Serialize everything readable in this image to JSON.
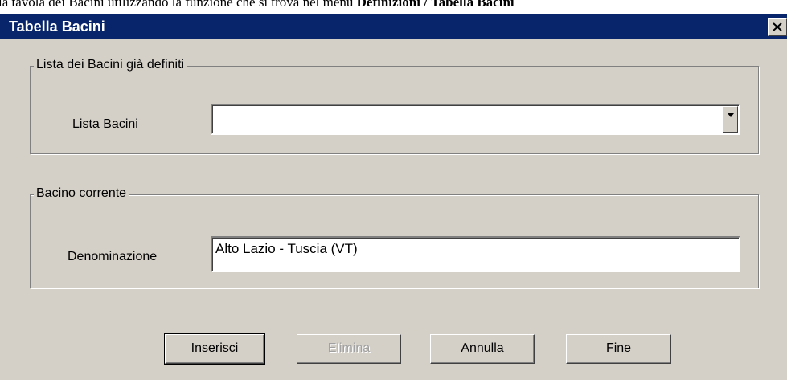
{
  "document": {
    "text_before": "la tavola dei Bacini utilizzando la funzione che si trova nel menu ",
    "text_bold": "Definizioni / Tabella Bacini"
  },
  "dialog": {
    "title": "Tabella Bacini",
    "close_glyph": "×"
  },
  "group_list": {
    "legend": "Lista dei Bacini già definiti",
    "label": "Lista Bacini",
    "selected_value": ""
  },
  "group_current": {
    "legend": "Bacino corrente",
    "label": "Denominazione",
    "value": "Alto Lazio - Tuscia (VT)"
  },
  "buttons": {
    "insert": "Inserisci",
    "delete": "Elimina",
    "cancel": "Annulla",
    "finish": "Fine"
  },
  "icons": {
    "close": "close-icon",
    "dropdown": "chevron-down-icon"
  },
  "colors": {
    "titlebar": "#08246b",
    "dialog_bg": "#d4d0c8",
    "disabled_text": "#a0a0a0"
  }
}
